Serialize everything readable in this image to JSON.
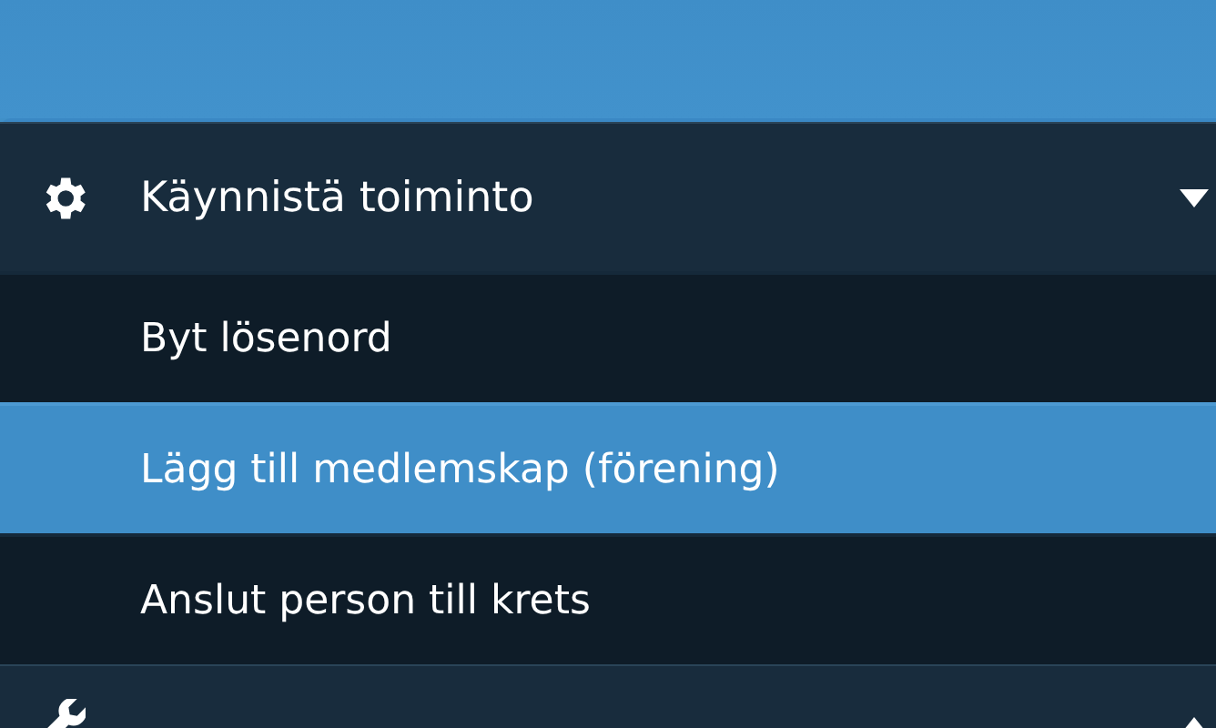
{
  "menu_sections": [
    {
      "kind": "gear",
      "title": "Käynnistä toiminto",
      "expanded": true,
      "items": [
        {
          "label": "Byt lösenord",
          "selected": false
        },
        {
          "label": "Lägg till medlemskap (förening)",
          "selected": true
        },
        {
          "label": "Anslut person till krets",
          "selected": false
        }
      ]
    },
    {
      "kind": "wrench",
      "expanded": false
    }
  ]
}
